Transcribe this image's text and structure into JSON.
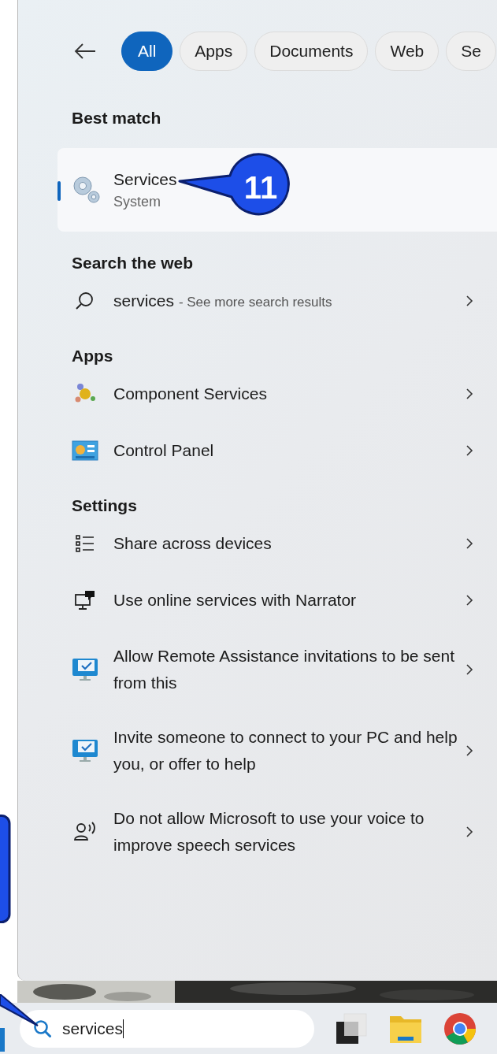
{
  "filters": [
    {
      "label": "All",
      "selected": true
    },
    {
      "label": "Apps",
      "selected": false
    },
    {
      "label": "Documents",
      "selected": false
    },
    {
      "label": "Web",
      "selected": false
    },
    {
      "label": "Se",
      "selected": false
    }
  ],
  "best_match": {
    "heading": "Best match",
    "title": "Services",
    "subtitle": "System",
    "selected": true
  },
  "callout": {
    "text": "11"
  },
  "web": {
    "heading": "Search the web",
    "query": "services",
    "hint": "- See more search results"
  },
  "apps": {
    "heading": "Apps",
    "items": [
      {
        "kind": "component",
        "label": "Component Services"
      },
      {
        "kind": "control-panel",
        "label": "Control Panel"
      }
    ]
  },
  "settings": {
    "heading": "Settings",
    "items": [
      {
        "kind": "list",
        "label": "Share across devices"
      },
      {
        "kind": "narrator",
        "label": "Use online services with Narrator"
      },
      {
        "kind": "monitor",
        "label": "Allow Remote Assistance invitations to be sent from this"
      },
      {
        "kind": "monitor",
        "label": "Invite someone to connect to your PC and help you, or offer to help"
      },
      {
        "kind": "speech",
        "label": "Do not allow Microsoft to use your voice to improve speech services"
      }
    ]
  },
  "taskbar": {
    "search_value": "services"
  }
}
